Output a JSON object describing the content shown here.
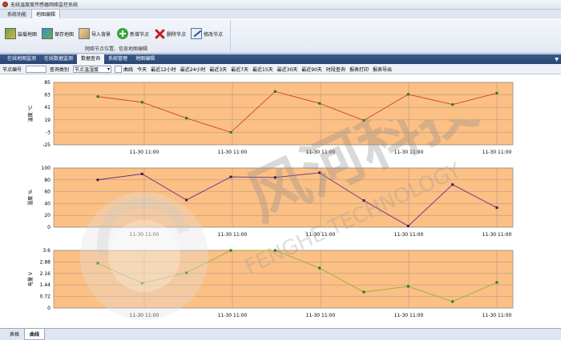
{
  "window": {
    "title": "无线温度度传感器网络监控系统"
  },
  "ribbon_tabs": [
    "系统功能",
    "地图编辑"
  ],
  "ribbon": {
    "buttons": [
      {
        "label": "装载地图",
        "icon": "load-map-icon"
      },
      {
        "label": "保存地图",
        "icon": "save-map-icon"
      },
      {
        "label": "导入背景",
        "icon": "import-background-icon"
      },
      {
        "label": "新增节点",
        "icon": "add-icon"
      },
      {
        "label": "删除节点",
        "icon": "delete-icon"
      },
      {
        "label": "修改节点",
        "icon": "edit-icon"
      }
    ],
    "group_caption": "网络节点位置、信息地图编辑"
  },
  "sub_tabs": [
    "在线地图监测",
    "在线数据监测",
    "数据查询",
    "系统管理",
    "地图编辑"
  ],
  "toolbar": {
    "node_label": "节点编号",
    "type_label": "查询类别",
    "type_value": "节点温湿度",
    "curve_label": "曲线",
    "ranges": [
      "今天",
      "最近12小时",
      "最近24小时",
      "最近3天",
      "最近7天",
      "最近15天",
      "最近30天",
      "最近90天",
      "时段查询",
      "报表打印",
      "报表导出"
    ]
  },
  "bottom_tabs": [
    "表格",
    "曲线"
  ],
  "watermark": {
    "cn": "风河科技",
    "en": "FENGHE TECHNOLOGY"
  },
  "colors": {
    "plot_bg": "#fcbf84",
    "temp_line": "#d0431a",
    "hum_line": "#6a2c8e",
    "volt_line": "#8ab53a",
    "marker": "#1a7d1a"
  },
  "chart_data": [
    {
      "type": "line",
      "ylabel": "温度 ℃",
      "yticks": [
        "85",
        "63",
        "41",
        "19",
        "-3",
        "-25"
      ],
      "ylim": [
        -25,
        85
      ],
      "xtick_label": "11-30 11:00",
      "series": [
        {
          "values": [
            60,
            50,
            22,
            -3,
            69,
            48,
            18,
            64,
            46,
            66
          ]
        }
      ]
    },
    {
      "type": "line",
      "ylabel": "湿度 %",
      "yticks": [
        "100",
        "80",
        "60",
        "40",
        "20",
        "0"
      ],
      "ylim": [
        0,
        100
      ],
      "xtick_label": "11-30 11:00",
      "series": [
        {
          "values": [
            80,
            90,
            46,
            85,
            84,
            92,
            45,
            2,
            72,
            33
          ]
        }
      ]
    },
    {
      "type": "line",
      "ylabel": "电量 V",
      "yticks": [
        "3.6",
        "2.88",
        "2.16",
        "1.44",
        "0.72",
        "0"
      ],
      "ylim": [
        0,
        3.6
      ],
      "xtick_label": "11-30 11:00",
      "series": [
        {
          "values": [
            2.8,
            1.55,
            2.2,
            3.6,
            3.6,
            2.5,
            1.0,
            1.35,
            0.4,
            1.6
          ]
        }
      ]
    }
  ]
}
